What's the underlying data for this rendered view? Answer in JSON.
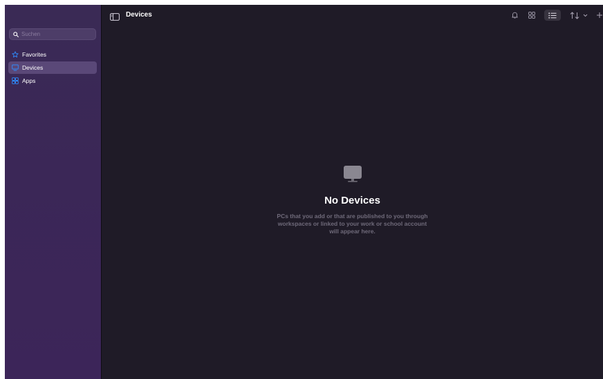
{
  "sidebar": {
    "search_placeholder": "Suchen",
    "items": [
      {
        "label": "Favorites",
        "icon": "star-icon",
        "active": false
      },
      {
        "label": "Devices",
        "icon": "monitor-icon",
        "active": true
      },
      {
        "label": "Apps",
        "icon": "grid-icon",
        "active": false
      }
    ]
  },
  "toolbar": {
    "title": "Devices",
    "icons": [
      "sidebar-toggle-icon",
      "bell-icon",
      "grid-view-icon",
      "list-view-icon",
      "sort-icon",
      "chevron-down-icon",
      "add-icon"
    ],
    "selected_view": "list"
  },
  "empty_state": {
    "icon": "monitor-icon",
    "title": "No Devices",
    "line1": "PCs that you add or that are published to you through",
    "line2": "workspaces or linked to your work or school account",
    "line3": "will appear here."
  },
  "colors": {
    "accent": "#2f8cff",
    "sidebar_bg": "#3b2857",
    "main_bg": "#1f1b27",
    "active_item_bg": "#5a4878"
  }
}
